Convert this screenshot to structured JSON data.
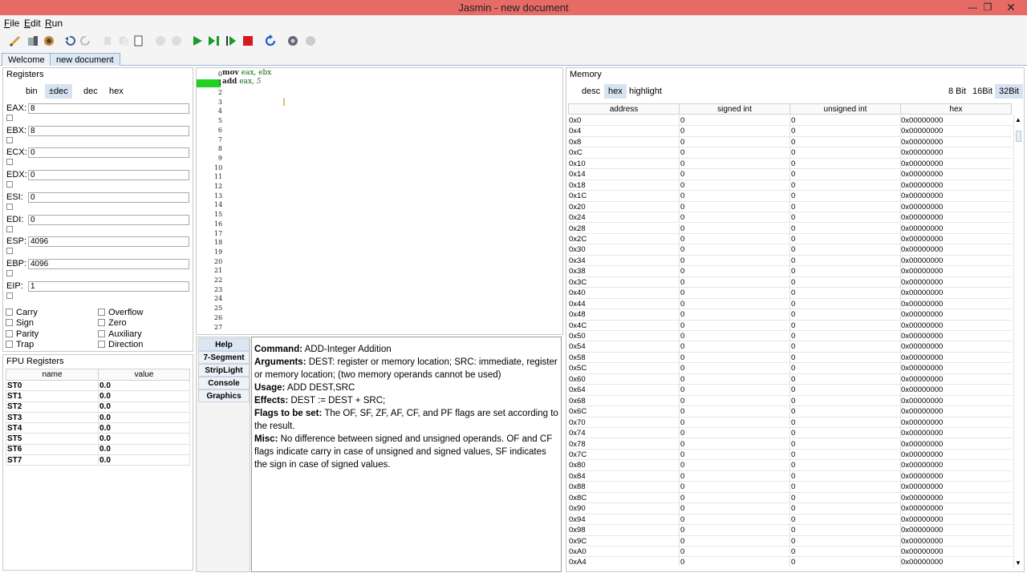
{
  "window": {
    "title": "Jasmin - new document",
    "minimize": "—",
    "maximize": "❐",
    "close": "✕"
  },
  "menu": [
    "File",
    "Edit",
    "Run"
  ],
  "tabs": [
    "Welcome",
    "new document"
  ],
  "registers": {
    "title": "Registers",
    "formats": [
      "bin",
      "±dec",
      "dec",
      "hex"
    ],
    "selected_format": "±dec",
    "items": [
      {
        "name": "EAX:",
        "value": "8"
      },
      {
        "name": "EBX:",
        "value": "8"
      },
      {
        "name": "ECX:",
        "value": "0"
      },
      {
        "name": "EDX:",
        "value": "0"
      },
      {
        "name": "ESI:",
        "value": "0"
      },
      {
        "name": "EDI:",
        "value": "0"
      },
      {
        "name": "ESP:",
        "value": "4096"
      },
      {
        "name": "EBP:",
        "value": "4096"
      },
      {
        "name": "EIP:",
        "value": "1"
      }
    ],
    "flags_left": [
      "Carry",
      "Sign",
      "Parity",
      "Trap"
    ],
    "flags_right": [
      "Overflow",
      "Zero",
      "Auxiliary",
      "Direction"
    ]
  },
  "fpu": {
    "title": "FPU Registers",
    "columns": [
      "name",
      "value"
    ],
    "rows": [
      [
        "ST0",
        "0.0"
      ],
      [
        "ST1",
        "0.0"
      ],
      [
        "ST2",
        "0.0"
      ],
      [
        "ST3",
        "0.0"
      ],
      [
        "ST4",
        "0.0"
      ],
      [
        "ST5",
        "0.0"
      ],
      [
        "ST6",
        "0.0"
      ],
      [
        "ST7",
        "0.0"
      ]
    ]
  },
  "editor": {
    "lines": [
      {
        "num": "0",
        "op": "mov",
        "args": "eax, ebx",
        "imm": ""
      },
      {
        "num": "1",
        "op": "add",
        "args": "eax, ",
        "imm": "5"
      }
    ],
    "line_numbers": [
      "2",
      "3",
      "4",
      "5",
      "6",
      "7",
      "8",
      "9",
      "10",
      "11",
      "12",
      "13",
      "14",
      "15",
      "16",
      "17",
      "18",
      "19",
      "20",
      "21",
      "22",
      "23",
      "24",
      "25",
      "26",
      "27"
    ]
  },
  "side_tabs": [
    "Help",
    "7-Segment",
    "StripLight",
    "Console",
    "Graphics"
  ],
  "help": {
    "command_label": "Command:",
    "command": " ADD-Integer Addition",
    "arguments_label": "Arguments:",
    "arguments": " DEST: register or memory location; SRC: immediate, register or memory location; (two memory operands cannot be used)",
    "usage_label": "Usage:",
    "usage": " ADD DEST,SRC",
    "effects_label": "Effects:",
    "effects": " DEST := DEST + SRC;",
    "flags_label": "Flags to be set:",
    "flags": " The OF, SF, ZF, AF, CF, and PF flags are set according to the result.",
    "misc_label": "Misc:",
    "misc": " No difference between signed and unsigned operands. OF and CF flags indicate carry in case of unsigned and signed values, SF indicates the sign in case of signed values."
  },
  "memory": {
    "title": "Memory",
    "left_buttons": [
      "desc",
      "hex",
      "highlight"
    ],
    "selected_left": "hex",
    "right_buttons": [
      "8 Bit",
      "16Bit",
      "32Bit"
    ],
    "selected_right": "32Bit",
    "columns": [
      "address",
      "signed int",
      "unsigned int",
      "hex"
    ],
    "addresses": [
      "0x0",
      "0x4",
      "0x8",
      "0xC",
      "0x10",
      "0x14",
      "0x18",
      "0x1C",
      "0x20",
      "0x24",
      "0x28",
      "0x2C",
      "0x30",
      "0x34",
      "0x38",
      "0x3C",
      "0x40",
      "0x44",
      "0x48",
      "0x4C",
      "0x50",
      "0x54",
      "0x58",
      "0x5C",
      "0x60",
      "0x64",
      "0x68",
      "0x6C",
      "0x70",
      "0x74",
      "0x78",
      "0x7C",
      "0x80",
      "0x84",
      "0x88",
      "0x8C",
      "0x90",
      "0x94",
      "0x98",
      "0x9C",
      "0xA0",
      "0xA4"
    ],
    "signed": "0",
    "unsigned": "0",
    "hex": "0x00000000"
  }
}
